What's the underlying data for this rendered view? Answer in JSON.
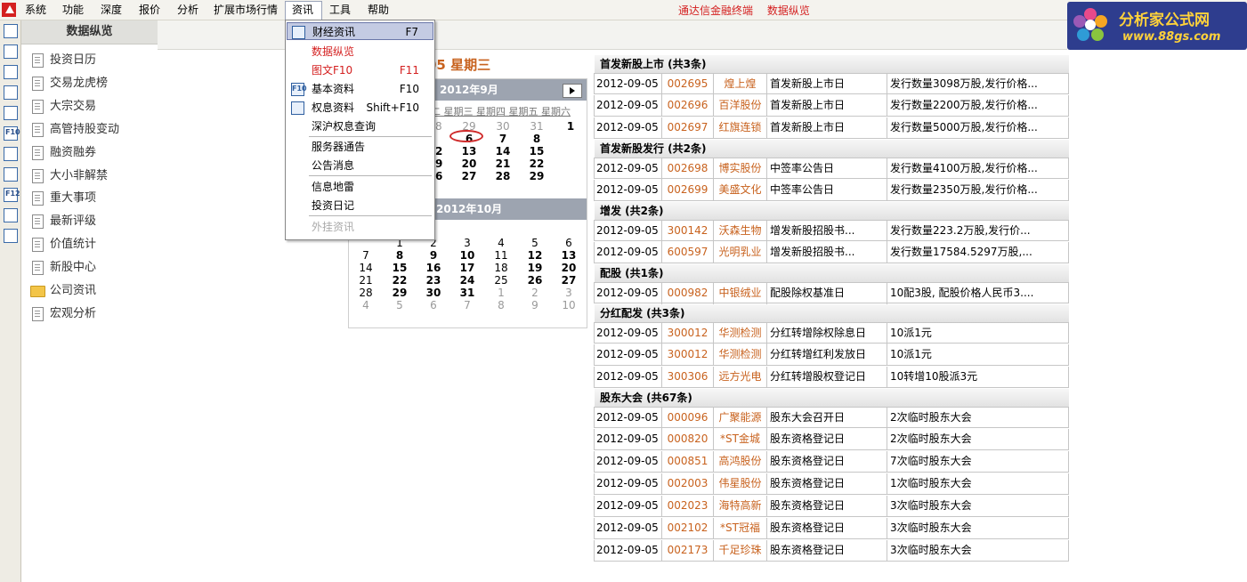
{
  "menubar": {
    "items": [
      "系统",
      "功能",
      "深度",
      "报价",
      "分析",
      "扩展市场行情",
      "资讯",
      "工具",
      "帮助"
    ],
    "center_title": [
      "通达信金融终端",
      "数据纵览"
    ]
  },
  "watermark": {
    "title": "分析家公式网",
    "url": "www.88gs.com"
  },
  "left_toolbar": {
    "fio_label": "F10",
    "f12_label": "F12"
  },
  "nav": {
    "header": "数据纵览",
    "items": [
      "投资日历",
      "交易龙虎榜",
      "大宗交易",
      "高管持股变动",
      "融资融券",
      "大小非解禁",
      "重大事项",
      "最新评级",
      "价值统计",
      "新股中心",
      "公司资讯",
      "宏观分析"
    ]
  },
  "calendar": {
    "date_title": "05  星期三",
    "sep_label": "2012年9月",
    "oct_label": "2012年10月",
    "weekday_text_sep": "二 星期三 星期四 星期五 星期六",
    "sep_rows": [
      [
        [
          "",
          "",
          ""
        ],
        [
          "28",
          "g",
          ""
        ],
        [
          "29",
          "g",
          ""
        ],
        [
          "30",
          "g",
          ""
        ],
        [
          "31",
          "g",
          ""
        ],
        [
          "1",
          "b",
          ""
        ]
      ],
      [
        [
          "",
          "",
          ""
        ],
        [
          "",
          "",
          ""
        ],
        [
          "6",
          "b",
          ""
        ],
        [
          "7",
          "b",
          ""
        ],
        [
          "8",
          "b",
          ""
        ],
        [
          "",
          ""
        ]
      ],
      [
        [
          "1",
          "b",
          ""
        ],
        [
          "12",
          "b",
          ""
        ],
        [
          "13",
          "b",
          ""
        ],
        [
          "14",
          "b",
          ""
        ],
        [
          "15",
          "b",
          ""
        ],
        [
          "",
          ""
        ]
      ],
      [
        [
          "8",
          "b",
          ""
        ],
        [
          "19",
          "b",
          ""
        ],
        [
          "20",
          "b",
          ""
        ],
        [
          "21",
          "b",
          ""
        ],
        [
          "22",
          "b",
          ""
        ],
        [
          "",
          ""
        ]
      ],
      [
        [
          "5",
          "b",
          ""
        ],
        [
          "26",
          "b",
          ""
        ],
        [
          "27",
          "b",
          ""
        ],
        [
          "28",
          "b",
          ""
        ],
        [
          "29",
          "b",
          ""
        ],
        [
          "",
          ""
        ]
      ]
    ],
    "oct_rows": [
      [
        "",
        "1",
        "2",
        "3",
        "4",
        "5",
        "6"
      ],
      [
        "7",
        "8",
        "9",
        "10",
        "11",
        "12",
        "13"
      ],
      [
        "14",
        "15",
        "16",
        "17",
        "18",
        "19",
        "20"
      ],
      [
        "21",
        "22",
        "23",
        "24",
        "25",
        "26",
        "27"
      ],
      [
        "28",
        "29",
        "30",
        "31",
        "1",
        "2",
        "3"
      ],
      [
        "4",
        "5",
        "6",
        "7",
        "8",
        "9",
        "10"
      ]
    ]
  },
  "sections": [
    {
      "title": "首发新股上市 (共3条)",
      "rows": [
        [
          "2012-09-05",
          "002695",
          "煌上煌",
          "首发新股上市日",
          "发行数量3098万股,发行价格..."
        ],
        [
          "2012-09-05",
          "002696",
          "百洋股份",
          "首发新股上市日",
          "发行数量2200万股,发行价格..."
        ],
        [
          "2012-09-05",
          "002697",
          "红旗连锁",
          "首发新股上市日",
          "发行数量5000万股,发行价格..."
        ]
      ]
    },
    {
      "title": "首发新股发行 (共2条)",
      "rows": [
        [
          "2012-09-05",
          "002698",
          "博实股份",
          "中签率公告日",
          "发行数量4100万股,发行价格..."
        ],
        [
          "2012-09-05",
          "002699",
          "美盛文化",
          "中签率公告日",
          "发行数量2350万股,发行价格..."
        ]
      ]
    },
    {
      "title": "增发 (共2条)",
      "rows": [
        [
          "2012-09-05",
          "300142",
          "沃森生物",
          "增发新股招股书...",
          "发行数量223.2万股,发行价..."
        ],
        [
          "2012-09-05",
          "600597",
          "光明乳业",
          "增发新股招股书...",
          "发行数量17584.5297万股,..."
        ]
      ]
    },
    {
      "title": "配股 (共1条)",
      "rows": [
        [
          "2012-09-05",
          "000982",
          "中银绒业",
          "配股除权基准日",
          "10配3股, 配股价格人民币3...."
        ]
      ]
    },
    {
      "title": "分红配发 (共3条)",
      "rows": [
        [
          "2012-09-05",
          "300012",
          "华测检测",
          "分红转增除权除息日",
          "10派1元"
        ],
        [
          "2012-09-05",
          "300012",
          "华测检测",
          "分红转增红利发放日",
          "10派1元"
        ],
        [
          "2012-09-05",
          "300306",
          "远方光电",
          "分红转增股权登记日",
          "10转增10股派3元"
        ]
      ]
    },
    {
      "title": "股东大会 (共67条)",
      "rows": [
        [
          "2012-09-05",
          "000096",
          "广聚能源",
          "股东大会召开日",
          "2次临时股东大会"
        ],
        [
          "2012-09-05",
          "000820",
          "*ST金城",
          "股东资格登记日",
          "2次临时股东大会"
        ],
        [
          "2012-09-05",
          "000851",
          "高鸿股份",
          "股东资格登记日",
          "7次临时股东大会"
        ],
        [
          "2012-09-05",
          "002003",
          "伟星股份",
          "股东资格登记日",
          "1次临时股东大会"
        ],
        [
          "2012-09-05",
          "002023",
          "海特高新",
          "股东资格登记日",
          "3次临时股东大会"
        ],
        [
          "2012-09-05",
          "002102",
          "*ST冠福",
          "股东资格登记日",
          "3次临时股东大会"
        ],
        [
          "2012-09-05",
          "002173",
          "千足珍珠",
          "股东资格登记日",
          "3次临时股东大会"
        ]
      ]
    }
  ],
  "dropdown": {
    "items": [
      {
        "label": "财经资讯",
        "key": "F7",
        "style": "sel",
        "icon": "news-icon"
      },
      {
        "label": "数据纵览",
        "key": "",
        "style": "red",
        "icon": ""
      },
      {
        "label": "图文F10",
        "key": "F11",
        "style": "red",
        "icon": ""
      },
      {
        "label": "基本资料",
        "key": "F10",
        "style": "",
        "icon": "f10-icon"
      },
      {
        "label": "权息资料",
        "key": "Shift+F10",
        "style": "",
        "icon": "copy-icon"
      },
      {
        "label": "深沪权息查询",
        "key": "",
        "style": "",
        "icon": ""
      },
      {
        "label": "服务器通告",
        "key": "",
        "style": "",
        "icon": ""
      },
      {
        "label": "公告消息",
        "key": "",
        "style": "",
        "icon": ""
      },
      {
        "label": "信息地雷",
        "key": "",
        "style": "",
        "icon": ""
      },
      {
        "label": "投资日记",
        "key": "",
        "style": "",
        "icon": ""
      },
      {
        "label": "外挂资讯",
        "key": "",
        "style": "dis",
        "icon": ""
      }
    ]
  }
}
